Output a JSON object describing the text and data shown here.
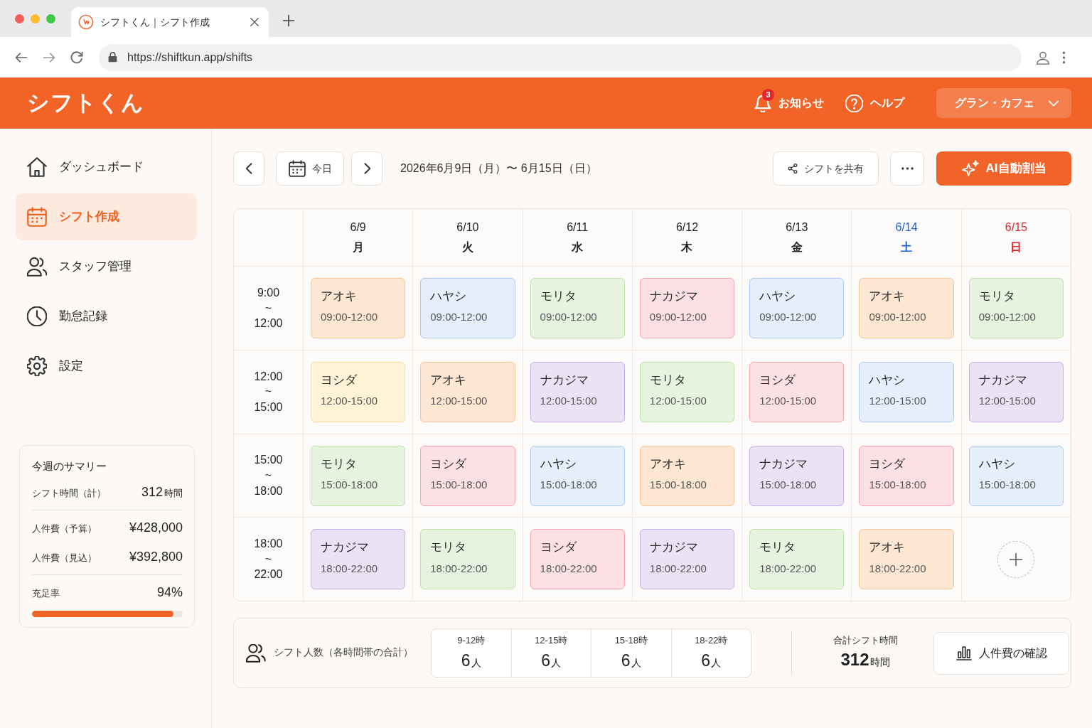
{
  "browser": {
    "tab": {
      "title": "シフトくん｜シフト作成"
    },
    "url": "https://shiftkun.app/shifts"
  },
  "header": {
    "logo": "シフトくん",
    "notifications": {
      "label": "お知らせ",
      "count": "3"
    },
    "help": "ヘルプ",
    "store": "グラン・カフェ"
  },
  "sidebar": {
    "items": [
      {
        "label": "ダッシュボード",
        "selected": false
      },
      {
        "label": "シフト作成",
        "selected": true
      },
      {
        "label": "スタッフ管理",
        "selected": false
      },
      {
        "label": "勤怠記録",
        "selected": false
      },
      {
        "label": "設定",
        "selected": false
      }
    ],
    "summary": {
      "title": "今週のサマリー",
      "total": {
        "label": "シフト時間（計）",
        "value": "312",
        "unit": "時間"
      },
      "costs": [
        {
          "label": "人件費（予算）",
          "value": "¥428,000"
        },
        {
          "label": "人件費（見込）",
          "value": "¥392,800"
        }
      ],
      "fill_rate": {
        "label": "充足率",
        "value": "94%",
        "level": 0.94
      }
    }
  },
  "toolbar": {
    "today": "今日",
    "range": "2026年6月9日（月）〜 6月15日（日）",
    "share": "シフトを共有",
    "auto_assign": "AI自動割当"
  },
  "schedule": {
    "days": [
      {
        "date": "6/9",
        "weekday": "月",
        "kind": "weekday"
      },
      {
        "date": "6/10",
        "weekday": "火",
        "kind": "weekday"
      },
      {
        "date": "6/11",
        "weekday": "水",
        "kind": "weekday"
      },
      {
        "date": "6/12",
        "weekday": "木",
        "kind": "weekday"
      },
      {
        "date": "6/13",
        "weekday": "金",
        "kind": "weekday"
      },
      {
        "date": "6/14",
        "weekday": "土",
        "kind": "saturday"
      },
      {
        "date": "6/15",
        "weekday": "日",
        "kind": "sunday"
      }
    ],
    "slots": [
      {
        "start": "9:00",
        "separator": "~",
        "end": "12:00",
        "cells": [
          {
            "kind": "shift",
            "name": "アオキ",
            "time": "09:00-12:00",
            "color": "#fde7d3"
          },
          {
            "kind": "shift",
            "name": "ハヤシ",
            "time": "09:00-12:00",
            "color": "#e5eefb"
          },
          {
            "kind": "shift",
            "name": "モリタ",
            "time": "09:00-12:00",
            "color": "#e5f3df"
          },
          {
            "kind": "shift",
            "name": "ナカジマ",
            "time": "09:00-12:00",
            "color": "#fde0e3"
          },
          {
            "kind": "shift",
            "name": "ハヤシ",
            "time": "09:00-12:00",
            "color": "#e5eefb"
          },
          {
            "kind": "shift",
            "name": "アオキ",
            "time": "09:00-12:00",
            "color": "#fde7d3"
          },
          {
            "kind": "shift",
            "name": "モリタ",
            "time": "09:00-12:00",
            "color": "#e5f3df"
          }
        ]
      },
      {
        "start": "12:00",
        "separator": "~",
        "end": "15:00",
        "cells": [
          {
            "kind": "shift",
            "name": "ヨシダ",
            "time": "12:00-15:00",
            "color": "#fff2d6"
          },
          {
            "kind": "shift",
            "name": "アオキ",
            "time": "12:00-15:00",
            "color": "#fde7d3"
          },
          {
            "kind": "shift",
            "name": "ナカジマ",
            "time": "12:00-15:00",
            "color": "#ebe2f5"
          },
          {
            "kind": "shift",
            "name": "モリタ",
            "time": "12:00-15:00",
            "color": "#e5f3df"
          },
          {
            "kind": "shift",
            "name": "ヨシダ",
            "time": "12:00-15:00",
            "color": "#fde0e3"
          },
          {
            "kind": "shift",
            "name": "ハヤシ",
            "time": "12:00-15:00",
            "color": "#e5eefb"
          },
          {
            "kind": "shift",
            "name": "ナカジマ",
            "time": "12:00-15:00",
            "color": "#ebe2f5"
          }
        ]
      },
      {
        "start": "15:00",
        "separator": "~",
        "end": "18:00",
        "cells": [
          {
            "kind": "shift",
            "name": "モリタ",
            "time": "15:00-18:00",
            "color": "#e5f3df"
          },
          {
            "kind": "shift",
            "name": "ヨシダ",
            "time": "15:00-18:00",
            "color": "#fde0e3"
          },
          {
            "kind": "shift",
            "name": "ハヤシ",
            "time": "15:00-18:00",
            "color": "#e5eefb"
          },
          {
            "kind": "shift",
            "name": "アオキ",
            "time": "15:00-18:00",
            "color": "#fde7d3"
          },
          {
            "kind": "shift",
            "name": "ナカジマ",
            "time": "15:00-18:00",
            "color": "#ebe2f5"
          },
          {
            "kind": "shift",
            "name": "ヨシダ",
            "time": "15:00-18:00",
            "color": "#fde0e3"
          },
          {
            "kind": "shift",
            "name": "ハヤシ",
            "time": "15:00-18:00",
            "color": "#e5eefb"
          }
        ]
      },
      {
        "start": "18:00",
        "separator": "~",
        "end": "22:00",
        "cells": [
          {
            "kind": "shift",
            "name": "ナカジマ",
            "time": "18:00-22:00",
            "color": "#ebe2f5"
          },
          {
            "kind": "shift",
            "name": "モリタ",
            "time": "18:00-22:00",
            "color": "#e5f3df"
          },
          {
            "kind": "shift",
            "name": "ヨシダ",
            "time": "18:00-22:00",
            "color": "#fde0e3"
          },
          {
            "kind": "shift",
            "name": "ナカジマ",
            "time": "18:00-22:00",
            "color": "#ebe2f5"
          },
          {
            "kind": "shift",
            "name": "モリタ",
            "time": "18:00-22:00",
            "color": "#e5f3df"
          },
          {
            "kind": "shift",
            "name": "アオキ",
            "time": "18:00-22:00",
            "color": "#fde7d3"
          },
          {
            "kind": "add"
          }
        ]
      }
    ]
  },
  "footer": {
    "staff_label": "シフト人数（各時間帯の合計）",
    "counts": [
      {
        "slot": "9-12時",
        "value": "6",
        "unit": "人"
      },
      {
        "slot": "12-15時",
        "value": "6",
        "unit": "人"
      },
      {
        "slot": "15-18時",
        "value": "6",
        "unit": "人"
      },
      {
        "slot": "18-22時",
        "value": "6",
        "unit": "人"
      }
    ],
    "total": {
      "label": "合計シフト時間",
      "value": "312",
      "unit": "時間"
    },
    "cost_button": "人件費の確認"
  }
}
